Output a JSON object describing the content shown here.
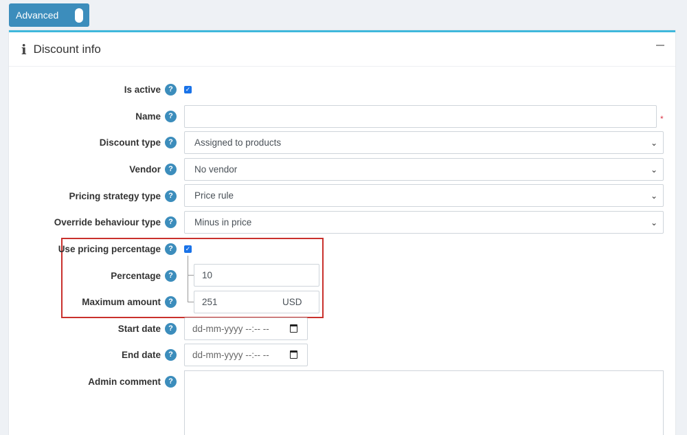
{
  "toggle": {
    "label": "Advanced"
  },
  "card": {
    "title": "Discount info"
  },
  "help_glyph": "?",
  "check_glyph": "✓",
  "required_marker": "*",
  "fields": {
    "is_active": {
      "label": "Is active",
      "checked": true
    },
    "name": {
      "label": "Name",
      "value": ""
    },
    "discount_type": {
      "label": "Discount type",
      "value": "Assigned to products"
    },
    "vendor": {
      "label": "Vendor",
      "value": "No vendor"
    },
    "pricing_strategy_type": {
      "label": "Pricing strategy type",
      "value": "Price rule"
    },
    "override_behaviour_type": {
      "label": "Override behaviour type",
      "value": "Minus in price"
    },
    "use_pricing_percentage": {
      "label": "Use pricing percentage",
      "checked": true
    },
    "percentage": {
      "label": "Percentage",
      "value": "10"
    },
    "maximum_amount": {
      "label": "Maximum amount",
      "value": "251",
      "currency": "USD"
    },
    "start_date": {
      "label": "Start date",
      "placeholder": "dd-mm-yyyy --:-- --"
    },
    "end_date": {
      "label": "End date",
      "placeholder": "dd-mm-yyyy --:-- --"
    },
    "admin_comment": {
      "label": "Admin comment",
      "value": ""
    }
  },
  "icons": {
    "chevron": "⌄",
    "info": "i"
  },
  "colors": {
    "accent": "#3c8dbc",
    "card_border": "#3fb8dc",
    "highlight": "#c9302c",
    "required": "#dc3545"
  }
}
